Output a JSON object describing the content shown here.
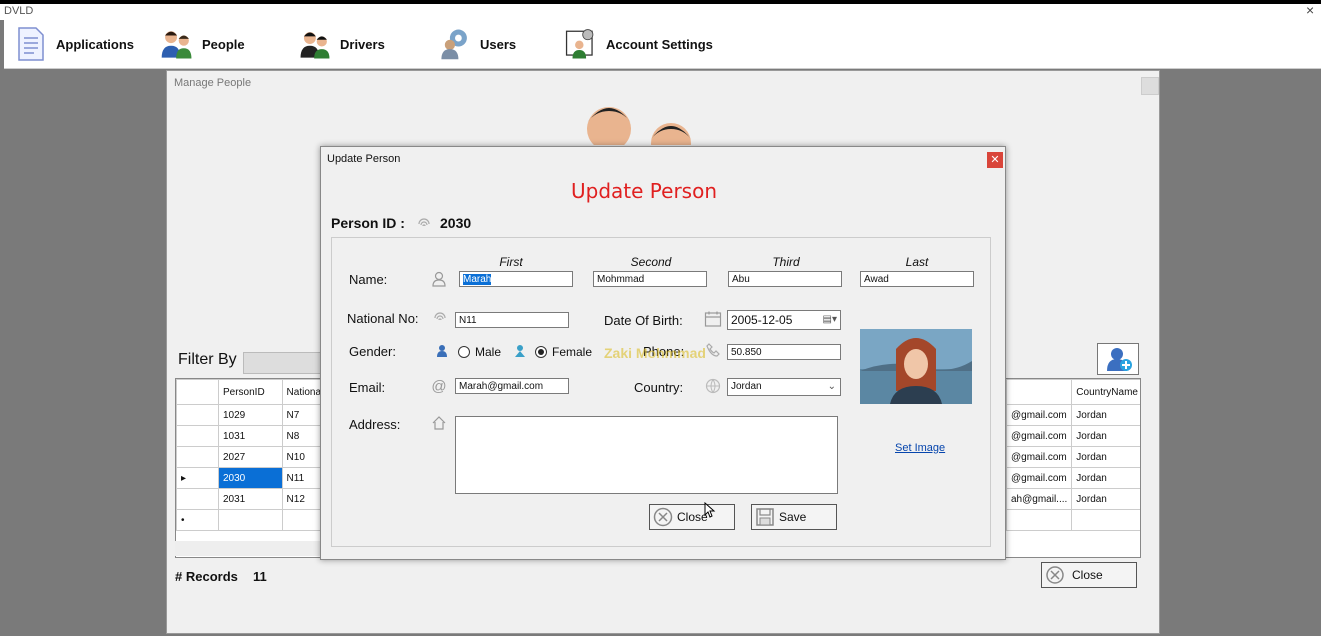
{
  "app": {
    "title": "DVLD",
    "close_icon": "×"
  },
  "menu": [
    {
      "label": "Applications",
      "icon": "document-icon"
    },
    {
      "label": "People",
      "icon": "people-icon"
    },
    {
      "label": "Drivers",
      "icon": "drivers-icon"
    },
    {
      "label": "Users",
      "icon": "users-gear-icon"
    },
    {
      "label": "Account Settings",
      "icon": "account-settings-icon"
    }
  ],
  "manage_people": {
    "title": "Manage People",
    "filter_label": "Filter By",
    "grid_left": {
      "headers": [
        "",
        "PersonID",
        "Nationa"
      ],
      "rows": [
        {
          "marker": "",
          "id": "1029",
          "nat": "N7"
        },
        {
          "marker": "",
          "id": "1031",
          "nat": "N8"
        },
        {
          "marker": "",
          "id": "2027",
          "nat": "N10"
        },
        {
          "marker": "▸",
          "id": "2030",
          "nat": "N11"
        },
        {
          "marker": "",
          "id": "2031",
          "nat": "N12"
        },
        {
          "marker": "•",
          "id": "",
          "nat": ""
        }
      ]
    },
    "grid_right": {
      "headers": [
        "",
        "CountryName"
      ],
      "rows": [
        {
          "email": "@gmail.com",
          "country": "Jordan"
        },
        {
          "email": "@gmail.com",
          "country": "Jordan"
        },
        {
          "email": "@gmail.com",
          "country": "Jordan"
        },
        {
          "email": "@gmail.com",
          "country": "Jordan"
        },
        {
          "email": "ah@gmail....",
          "country": "Jordan"
        },
        {
          "email": "",
          "country": ""
        }
      ]
    },
    "records_label": "# Records",
    "records_count": "11",
    "close_label": "Close"
  },
  "dialog": {
    "window_title": "Update Person",
    "heading": "Update Person",
    "person_id_label": "Person ID :",
    "person_id_value": "2030",
    "name_label": "Name:",
    "name_parts": {
      "first_label": "First",
      "first_value": "Marah",
      "second_label": "Second",
      "second_value": "Mohmmad",
      "third_label": "Third",
      "third_value": "Abu",
      "last_label": "Last",
      "last_value": "Awad"
    },
    "national_no_label": "National No:",
    "national_no_value": "N11",
    "dob_label": "Date Of Birth:",
    "dob_value": "2005-12-05",
    "gender_label": "Gender:",
    "gender_male": "Male",
    "gender_female": "Female",
    "gender_selected": "Female",
    "phone_label": "Phone:",
    "phone_value": "50.850",
    "email_label": "Email:",
    "email_value": "Marah@gmail.com",
    "country_label": "Country:",
    "country_value": "Jordan",
    "address_label": "Address:",
    "address_value": "",
    "set_image_label": "Set Image",
    "close_label": "Close",
    "save_label": "Save",
    "watermark": "Zaki Mohmmad"
  }
}
